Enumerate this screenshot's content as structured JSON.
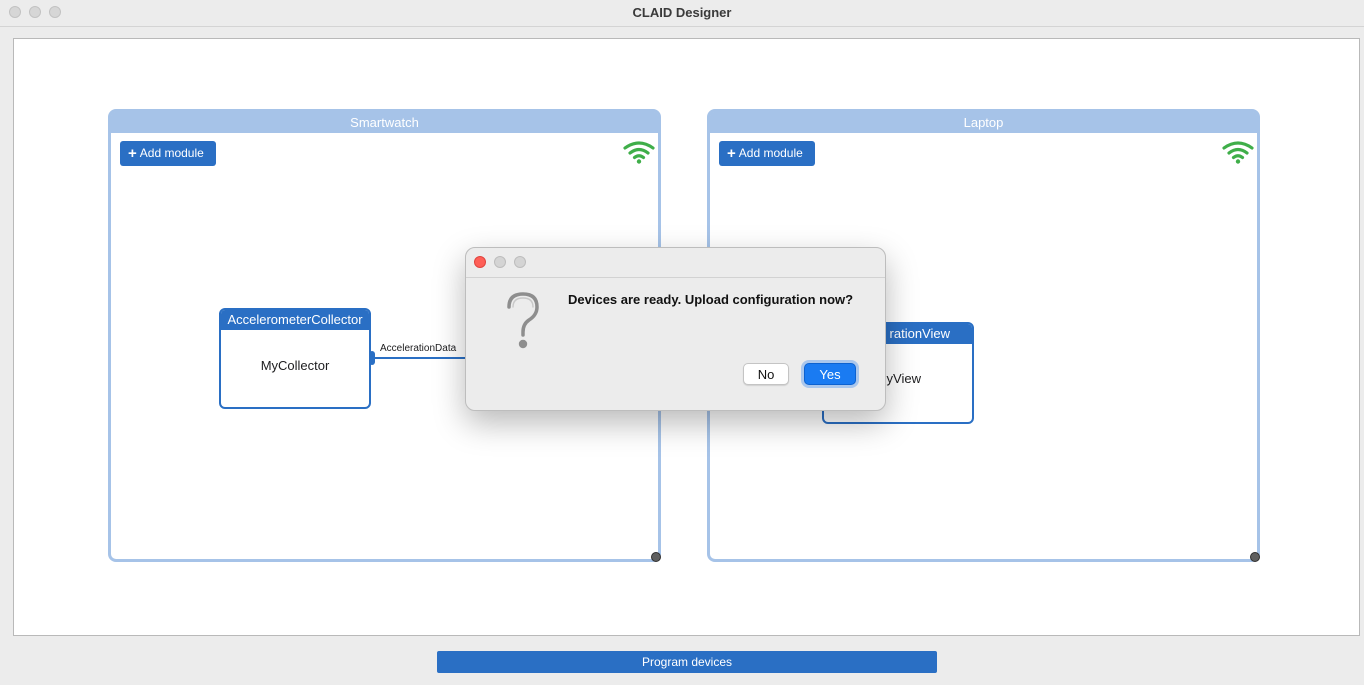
{
  "window": {
    "title": "CLAID Designer"
  },
  "devices": [
    {
      "name": "Smartwatch",
      "add_module_label": "Add module",
      "status_icon": "wifi-connected-icon",
      "modules": [
        {
          "type": "AccelerometerCollector",
          "name": "MyCollector"
        }
      ],
      "connection_label": "AccelerationData"
    },
    {
      "name": "Laptop",
      "add_module_label": "Add module",
      "status_icon": "wifi-connected-icon",
      "modules": [
        {
          "type": "rationView",
          "name": "yView"
        }
      ]
    }
  ],
  "dialog": {
    "icon": "question-mark-icon",
    "message": "Devices are ready. Upload configuration now?",
    "no_label": "No",
    "yes_label": "Yes"
  },
  "footer": {
    "program_label": "Program devices"
  },
  "colors": {
    "accent": "#2a6fc4",
    "device_border": "#a6c3e8",
    "wifi": "#3fae49",
    "dialog_default_button": "#1a7bf2"
  }
}
